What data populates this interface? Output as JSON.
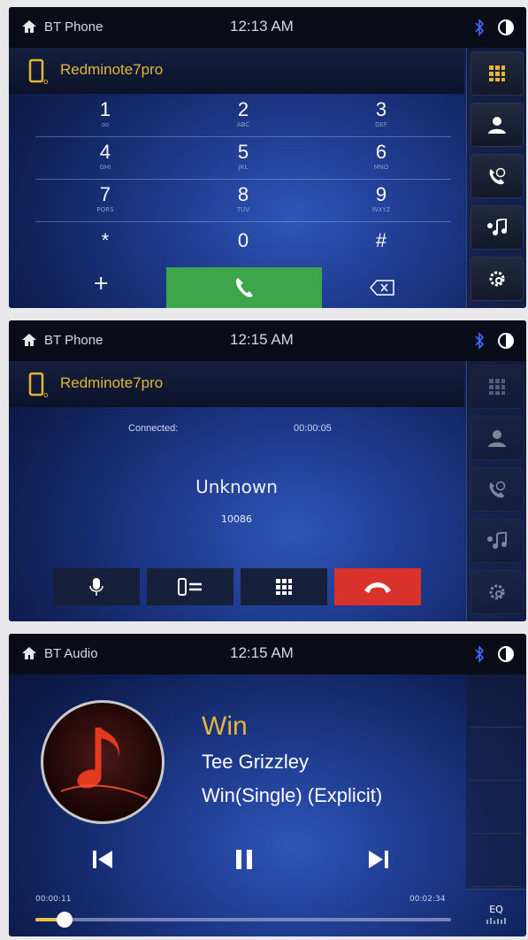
{
  "colors": {
    "accent": "#e3b63a",
    "call_green": "#3da64a",
    "end_red": "#d9322a",
    "progress": "#e8c24a"
  },
  "screen1": {
    "source": "BT Phone",
    "clock": "12:13 AM",
    "device": "Redminote7pro",
    "keys": [
      {
        "num": "1",
        "sub": "oo"
      },
      {
        "num": "2",
        "sub": "ABC"
      },
      {
        "num": "3",
        "sub": "DEF"
      },
      {
        "num": "4",
        "sub": "GHI"
      },
      {
        "num": "5",
        "sub": "JKL"
      },
      {
        "num": "6",
        "sub": "MNO"
      },
      {
        "num": "7",
        "sub": "PQRS"
      },
      {
        "num": "8",
        "sub": "TUV"
      },
      {
        "num": "9",
        "sub": "WXYZ"
      },
      {
        "num": "*",
        "sub": ""
      },
      {
        "num": "0",
        "sub": ""
      },
      {
        "num": "#",
        "sub": ""
      }
    ],
    "plus": "+",
    "sidebar": [
      "keypad-icon",
      "contacts-icon",
      "call-log-icon",
      "bt-music-icon",
      "settings-icon"
    ]
  },
  "screen2": {
    "source": "BT Phone",
    "clock": "12:15 AM",
    "device": "Redminote7pro",
    "status_label": "Connected:",
    "duration": "00:00:05",
    "caller_name": "Unknown",
    "caller_number": "10086"
  },
  "screen3": {
    "source": "BT Audio",
    "clock": "12:15 AM",
    "title": "Win",
    "artist": "Tee Grizzley",
    "album": "Win(Single) (Explicit)",
    "elapsed": "00:00:11",
    "total": "00:02:34",
    "progress_fraction": 0.07,
    "eq_label": "EQ"
  }
}
